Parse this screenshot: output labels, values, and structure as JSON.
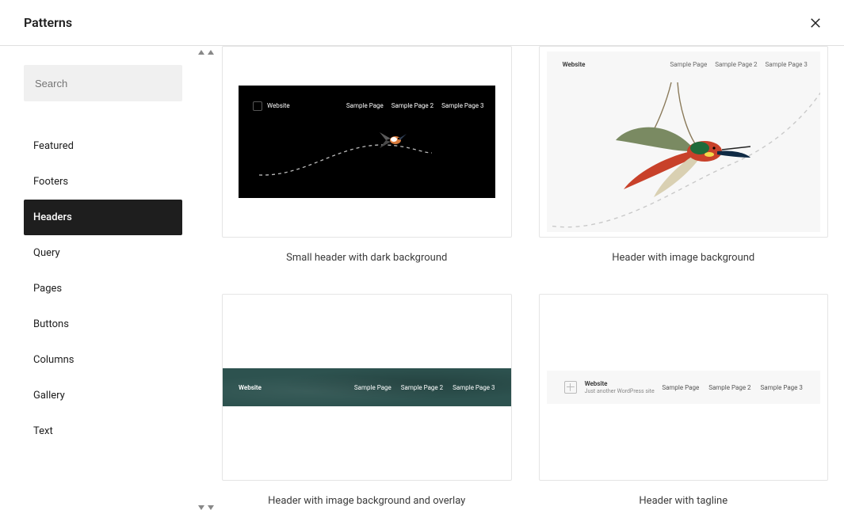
{
  "header": {
    "title": "Patterns"
  },
  "search": {
    "placeholder": "Search"
  },
  "categories": [
    {
      "label": "Featured",
      "active": false
    },
    {
      "label": "Footers",
      "active": false
    },
    {
      "label": "Headers",
      "active": true
    },
    {
      "label": "Query",
      "active": false
    },
    {
      "label": "Pages",
      "active": false
    },
    {
      "label": "Buttons",
      "active": false
    },
    {
      "label": "Columns",
      "active": false
    },
    {
      "label": "Gallery",
      "active": false
    },
    {
      "label": "Text",
      "active": false
    }
  ],
  "patterns": [
    {
      "title": "Small header with dark background",
      "site_title": "Website",
      "nav": [
        "Sample Page",
        "Sample Page 2",
        "Sample Page 3"
      ]
    },
    {
      "title": "Header with image background",
      "site_title": "Website",
      "nav": [
        "Sample Page",
        "Sample Page 2",
        "Sample Page 3"
      ]
    },
    {
      "title": "Header with image background and overlay",
      "site_title": "Website",
      "nav": [
        "Sample Page",
        "Sample Page 2",
        "Sample Page 3"
      ]
    },
    {
      "title": "Header with tagline",
      "site_title": "Website",
      "tagline": "Just another WordPress site",
      "nav": [
        "Sample Page",
        "Sample Page 2",
        "Sample Page 3"
      ]
    }
  ]
}
